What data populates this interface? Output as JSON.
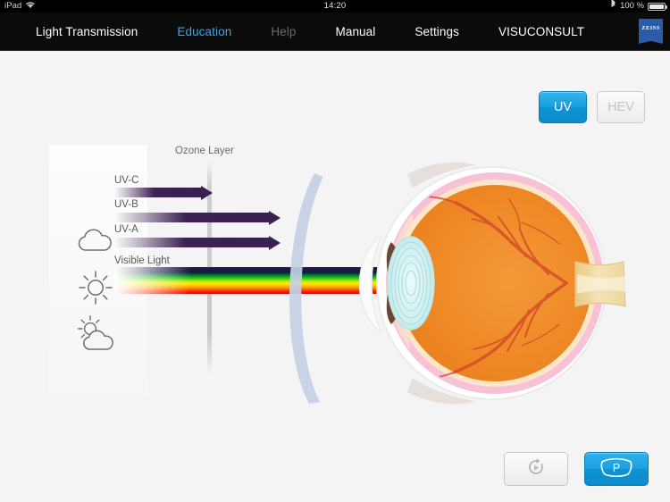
{
  "status_bar": {
    "device": "iPad",
    "wifi_icon": "wifi-icon",
    "time": "14:20",
    "bluetooth_icon": "bluetooth-icon",
    "battery_percent": "100 %",
    "battery_icon": "battery-full-icon"
  },
  "nav": {
    "items": [
      {
        "label": "Light Transmission",
        "state": "normal"
      },
      {
        "label": "Education",
        "state": "active"
      },
      {
        "label": "Help",
        "state": "disabled"
      },
      {
        "label": "Manual",
        "state": "normal"
      },
      {
        "label": "Settings",
        "state": "normal"
      },
      {
        "label": "VISUCONSULT",
        "state": "normal"
      }
    ],
    "brand": "ZEISS",
    "active_color": "#3da5e8",
    "disabled_color": "#6a6a6a"
  },
  "mode_toggle": {
    "uv_label": "UV",
    "hev_label": "HEV",
    "selected": "UV",
    "active_color": "#17a0df",
    "inactive_text_color": "#c2c2c2"
  },
  "diagram": {
    "ozone_label": "Ozone Layer",
    "rays": [
      {
        "label": "UV-C",
        "icon": "cloud-icon",
        "color": "#3a2050",
        "blocked_by_ozone": true
      },
      {
        "label": "UV-B",
        "icon": "sun-icon",
        "color": "#3a2050",
        "blocked_by_ozone": false
      },
      {
        "label": "UV-A",
        "icon": "sun-icon",
        "color": "#3a2050",
        "blocked_by_ozone": false
      },
      {
        "label": "Visible Light",
        "icon": "sun-behind-cloud-icon",
        "color": "spectrum",
        "blocked_by_ozone": false
      }
    ],
    "spectacle_lens_name": "spectacle-lens",
    "eye_name": "human-eye-cross-section",
    "spectrum_colors": [
      "#2b1b4d",
      "#0a1f3a",
      "#12b324",
      "#c8ee00",
      "#ffe400",
      "#ff6a00",
      "#e00000"
    ],
    "eye_colors": {
      "sclera": "#ffffff",
      "choroid": "#f6c3d4",
      "retina": "#f08a2a",
      "vitreous": "#ef8b28",
      "lens": "#d6f2f2",
      "iris": "#6b4630",
      "optic_nerve": "#f0d9a0",
      "vessels": "#d94b2b"
    }
  },
  "bottom_bar": {
    "replay_button": {
      "icon": "replay-icon",
      "enabled": false
    },
    "lens_button": {
      "icon": "lens-p-icon",
      "label": "P",
      "enabled": true
    }
  }
}
